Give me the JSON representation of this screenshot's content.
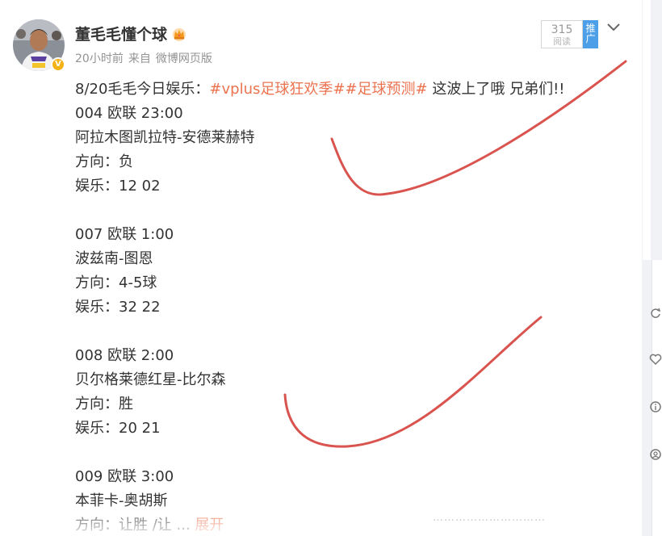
{
  "post": {
    "username": "董毛毛懂个球",
    "verified_badge": "V",
    "time": "20小时前",
    "source_prefix": "来自",
    "source": "微博网页版",
    "read_count": "315",
    "read_label": "阅读",
    "promote_label": "推广",
    "intro_text": "8/20毛毛今日娱乐：",
    "hashtag1": "#vplus足球狂欢季#",
    "hashtag2": "#足球预测#",
    "intro_tail": " 这波上了哦 兄弟们!!",
    "matches": [
      {
        "header": "004 欧联 23:00",
        "teams": "阿拉木图凯拉特-安德莱赫特",
        "direction": "方向：负",
        "fun": "娱乐：12 02"
      },
      {
        "header": "007 欧联 1:00",
        "teams": "波兹南-图恩",
        "direction": "方向：4-5球",
        "fun": "娱乐：32 22"
      },
      {
        "header": "008 欧联 2:00",
        "teams": "贝尔格莱德红星-比尔森",
        "direction": "方向：胜",
        "fun": "娱乐：20 21"
      },
      {
        "header": "009 欧联 3:00",
        "teams": "本菲卡-奥胡斯",
        "direction": "方向：让胜 /让 ...",
        "expand": "展开"
      }
    ],
    "bottom_dots": "…………………………"
  },
  "colors": {
    "accent": "#eb7350",
    "promote": "#4d9fe8",
    "annotation_stroke": "#d9534f"
  },
  "icons": [
    "crown-icon",
    "chevron-down-icon",
    "refresh-icon",
    "heart-icon",
    "info-icon",
    "person-icon"
  ]
}
